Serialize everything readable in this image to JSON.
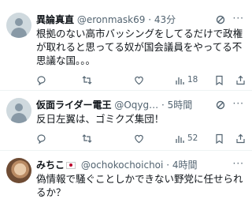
{
  "tweets": [
    {
      "name": "異論真直",
      "handle": "@eronmask69",
      "sep": "·",
      "time": "43分",
      "text": "根拠のない高市バッシングをしてるだけで政権が取れると思ってる奴が国会議員をやってる不思議な国。。。",
      "views": "18"
    },
    {
      "name": "仮面ライダー電王",
      "handle": "@Oqyg…",
      "sep": "·",
      "time": "5時間",
      "text": "反日左翼は、ゴミクズ集団！",
      "views": "52"
    },
    {
      "name": "みちこ",
      "handle": "@ochokochoichoi",
      "sep": "·",
      "time": "4時間",
      "text": "偽情報で騒ぐことしかできない野党に任せられるか？",
      "views": ""
    }
  ],
  "icons": {
    "reply": "reply-icon",
    "retweet": "retweet-icon",
    "like": "like-icon",
    "views": "views-icon",
    "bookmark": "bookmark-icon",
    "share": "share-icon",
    "grok": "grok-icon",
    "more": "more-icon"
  },
  "colors": {
    "text": "#0f1419",
    "secondary": "#536471",
    "divider": "#eff3f4"
  }
}
